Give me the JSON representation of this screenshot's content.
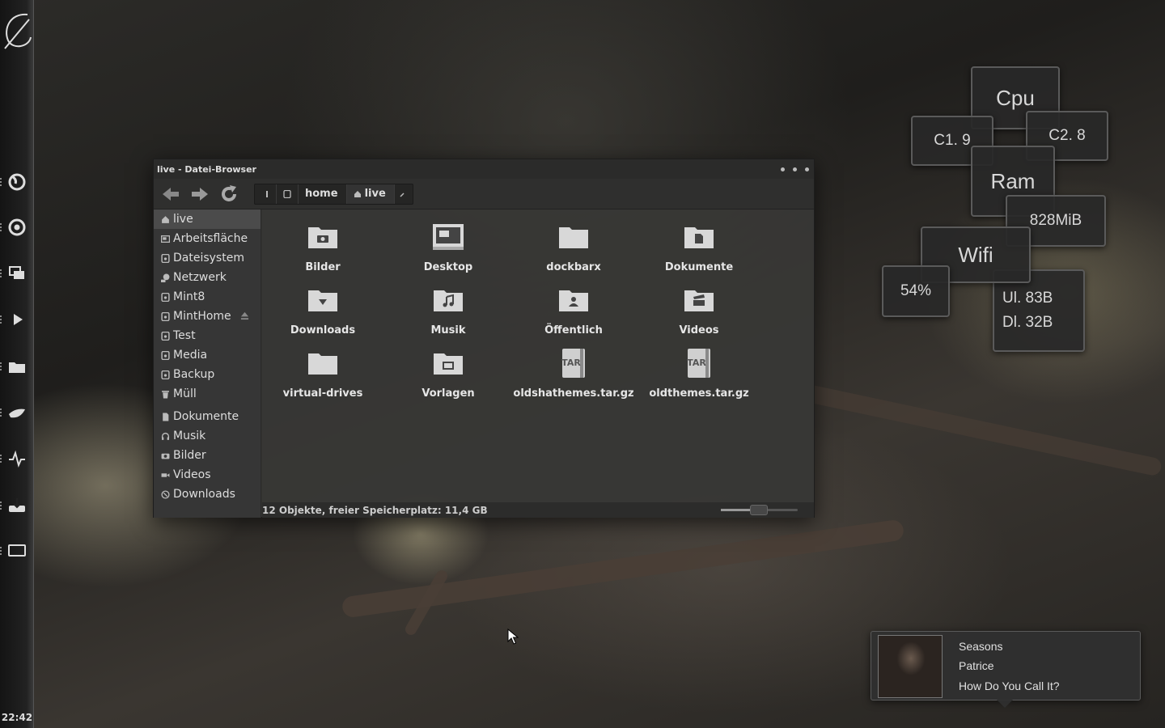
{
  "clock": "22:42",
  "window": {
    "title": "live - Datei-Browser",
    "path": {
      "segments": [
        "home",
        "live"
      ]
    },
    "sidebar": [
      {
        "label": "live",
        "icon": "home-icon",
        "selected": true
      },
      {
        "label": "Arbeitsfläche",
        "icon": "desktop-icon"
      },
      {
        "label": "Dateisystem",
        "icon": "drive-icon"
      },
      {
        "label": "Netzwerk",
        "icon": "network-icon"
      },
      {
        "label": "Mint8",
        "icon": "drive-icon"
      },
      {
        "label": "MintHome",
        "icon": "drive-icon"
      },
      {
        "label": "Test",
        "icon": "drive-icon"
      },
      {
        "label": "Media",
        "icon": "drive-icon"
      },
      {
        "label": "Backup",
        "icon": "drive-icon"
      },
      {
        "label": "Müll",
        "icon": "trash-icon"
      },
      {
        "label": "Dokumente",
        "icon": "document-icon"
      },
      {
        "label": "Musik",
        "icon": "headphones-icon"
      },
      {
        "label": "Bilder",
        "icon": "camera-icon"
      },
      {
        "label": "Videos",
        "icon": "video-icon"
      },
      {
        "label": "Downloads",
        "icon": "download-icon"
      }
    ],
    "files": [
      {
        "label": "Bilder",
        "icon": "pictures-folder-icon"
      },
      {
        "label": "Desktop",
        "icon": "desktop-folder-icon"
      },
      {
        "label": "dockbarx",
        "icon": "folder-icon"
      },
      {
        "label": "Dokumente",
        "icon": "documents-folder-icon"
      },
      {
        "label": "Downloads",
        "icon": "downloads-folder-icon"
      },
      {
        "label": "Musik",
        "icon": "music-folder-icon"
      },
      {
        "label": "Öffentlich",
        "icon": "public-folder-icon"
      },
      {
        "label": "Videos",
        "icon": "videos-folder-icon"
      },
      {
        "label": "virtual-drives",
        "icon": "folder-icon"
      },
      {
        "label": "Vorlagen",
        "icon": "templates-folder-icon"
      },
      {
        "label": "oldshathemes.tar.gz",
        "icon": "tar-archive-icon",
        "badge": "TAR"
      },
      {
        "label": "oldthemes.tar.gz",
        "icon": "tar-archive-icon",
        "badge": "TAR"
      }
    ],
    "status": "12 Objekte, freier Speicherplatz: 11,4 GB"
  },
  "monitor": {
    "cpu": "Cpu",
    "core1": "C1. 9",
    "core2": "C2. 8",
    "ram": "Ram",
    "ram_value": "828MiB",
    "wifi": "Wifi",
    "wifi_signal": "54%",
    "upload": "Ul. 83B",
    "download": "Dl. 32B"
  },
  "music": {
    "title": "Seasons",
    "artist": "Patrice",
    "album": "How Do You Call It?"
  }
}
